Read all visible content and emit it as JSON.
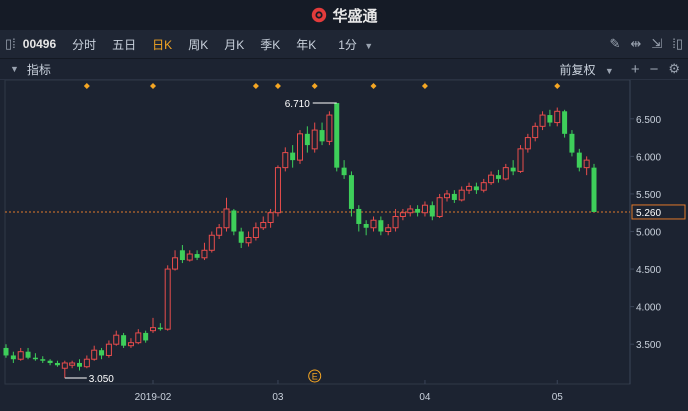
{
  "app": {
    "brand": "华盛通"
  },
  "toolbar": {
    "code": "00496",
    "periods": [
      "分时",
      "五日",
      "日K",
      "周K",
      "月K",
      "季K",
      "年K"
    ],
    "active_period": "日K",
    "minute_select": "1分"
  },
  "subbar": {
    "indicator_label": "指标",
    "adjust_label": "前复权"
  },
  "chart_data": {
    "type": "candlestick",
    "y_ticks": [
      "6.500",
      "6.000",
      "5.500",
      "5.000",
      "4.500",
      "4.000",
      "3.500"
    ],
    "y_tick_values": [
      6.5,
      6.0,
      5.5,
      5.0,
      4.5,
      4.0,
      3.5
    ],
    "ylim": [
      3.05,
      6.95
    ],
    "x_labels": [
      "2019-02",
      "03",
      "04",
      "05"
    ],
    "x_label_index": [
      20,
      37,
      57,
      75
    ],
    "current_price": "5.260",
    "current_price_value": 5.26,
    "high_label": "6.710",
    "high_index": 45,
    "low_label": "3.050",
    "low_index": 8,
    "event_marker": "E",
    "event_index": 42,
    "dividend_marks": [
      11,
      20,
      34,
      37,
      42,
      50,
      57,
      75
    ],
    "candles": [
      [
        3.45,
        3.35,
        3.5,
        3.32
      ],
      [
        3.35,
        3.3,
        3.4,
        3.25
      ],
      [
        3.3,
        3.4,
        3.45,
        3.28
      ],
      [
        3.4,
        3.32,
        3.45,
        3.3
      ],
      [
        3.32,
        3.3,
        3.38,
        3.28
      ],
      [
        3.3,
        3.28,
        3.34,
        3.25
      ],
      [
        3.28,
        3.25,
        3.3,
        3.22
      ],
      [
        3.25,
        3.22,
        3.28,
        3.2
      ],
      [
        3.18,
        3.25,
        3.28,
        3.05
      ],
      [
        3.22,
        3.25,
        3.28,
        3.18
      ],
      [
        3.25,
        3.2,
        3.3,
        3.15
      ],
      [
        3.2,
        3.3,
        3.35,
        3.18
      ],
      [
        3.3,
        3.42,
        3.48,
        3.28
      ],
      [
        3.42,
        3.35,
        3.45,
        3.3
      ],
      [
        3.35,
        3.5,
        3.55,
        3.32
      ],
      [
        3.5,
        3.62,
        3.68,
        3.48
      ],
      [
        3.62,
        3.48,
        3.65,
        3.45
      ],
      [
        3.48,
        3.52,
        3.58,
        3.45
      ],
      [
        3.52,
        3.65,
        3.7,
        3.5
      ],
      [
        3.65,
        3.55,
        3.68,
        3.52
      ],
      [
        3.68,
        3.72,
        3.85,
        3.65
      ],
      [
        3.72,
        3.7,
        3.78,
        3.68
      ],
      [
        3.7,
        4.5,
        4.55,
        3.68
      ],
      [
        4.5,
        4.65,
        4.75,
        4.48
      ],
      [
        4.75,
        4.62,
        4.82,
        4.58
      ],
      [
        4.62,
        4.7,
        4.75,
        4.6
      ],
      [
        4.7,
        4.65,
        4.75,
        4.62
      ],
      [
        4.65,
        4.75,
        4.85,
        4.62
      ],
      [
        4.75,
        4.95,
        5.0,
        4.72
      ],
      [
        4.95,
        5.05,
        5.1,
        4.9
      ],
      [
        5.05,
        5.3,
        5.45,
        5.0
      ],
      [
        5.28,
        5.0,
        5.3,
        4.95
      ],
      [
        5.0,
        4.85,
        5.05,
        4.78
      ],
      [
        4.85,
        4.92,
        5.0,
        4.8
      ],
      [
        4.92,
        5.05,
        5.12,
        4.88
      ],
      [
        5.05,
        5.12,
        5.2,
        5.02
      ],
      [
        5.12,
        5.25,
        5.3,
        5.05
      ],
      [
        5.25,
        5.85,
        5.88,
        5.2
      ],
      [
        5.85,
        6.05,
        6.12,
        5.8
      ],
      [
        6.05,
        5.95,
        6.15,
        5.85
      ],
      [
        5.95,
        6.3,
        6.35,
        5.9
      ],
      [
        6.3,
        6.15,
        6.4,
        6.05
      ],
      [
        6.1,
        6.35,
        6.45,
        6.05
      ],
      [
        6.35,
        6.2,
        6.45,
        6.15
      ],
      [
        6.2,
        6.55,
        6.6,
        6.15
      ],
      [
        6.71,
        5.85,
        6.71,
        5.8
      ],
      [
        5.85,
        5.75,
        5.95,
        5.7
      ],
      [
        5.75,
        5.3,
        5.8,
        5.2
      ],
      [
        5.3,
        5.1,
        5.35,
        5.0
      ],
      [
        5.1,
        5.05,
        5.15,
        4.95
      ],
      [
        5.05,
        5.15,
        5.2,
        5.0
      ],
      [
        5.15,
        5.0,
        5.2,
        4.95
      ],
      [
        5.0,
        5.05,
        5.1,
        4.95
      ],
      [
        5.05,
        5.2,
        5.3,
        5.0
      ],
      [
        5.2,
        5.25,
        5.3,
        5.15
      ],
      [
        5.25,
        5.3,
        5.35,
        5.2
      ],
      [
        5.3,
        5.25,
        5.35,
        5.2
      ],
      [
        5.25,
        5.35,
        5.4,
        5.2
      ],
      [
        5.35,
        5.2,
        5.4,
        5.15
      ],
      [
        5.2,
        5.45,
        5.5,
        5.18
      ],
      [
        5.45,
        5.5,
        5.55,
        5.4
      ],
      [
        5.5,
        5.42,
        5.55,
        5.38
      ],
      [
        5.42,
        5.55,
        5.6,
        5.4
      ],
      [
        5.55,
        5.6,
        5.65,
        5.5
      ],
      [
        5.6,
        5.55,
        5.65,
        5.5
      ],
      [
        5.55,
        5.65,
        5.7,
        5.52
      ],
      [
        5.65,
        5.75,
        5.8,
        5.62
      ],
      [
        5.75,
        5.7,
        5.82,
        5.65
      ],
      [
        5.7,
        5.85,
        5.9,
        5.68
      ],
      [
        5.85,
        5.8,
        5.95,
        5.75
      ],
      [
        5.8,
        6.1,
        6.15,
        5.78
      ],
      [
        6.1,
        6.25,
        6.3,
        6.05
      ],
      [
        6.25,
        6.4,
        6.45,
        6.2
      ],
      [
        6.4,
        6.55,
        6.6,
        6.35
      ],
      [
        6.55,
        6.45,
        6.62,
        6.4
      ],
      [
        6.45,
        6.6,
        6.65,
        6.4
      ],
      [
        6.6,
        6.3,
        6.62,
        6.25
      ],
      [
        6.3,
        6.05,
        6.35,
        6.0
      ],
      [
        6.05,
        5.85,
        6.1,
        5.8
      ],
      [
        5.85,
        5.95,
        6.0,
        5.75
      ],
      [
        5.85,
        5.26,
        5.9,
        5.26
      ]
    ]
  }
}
